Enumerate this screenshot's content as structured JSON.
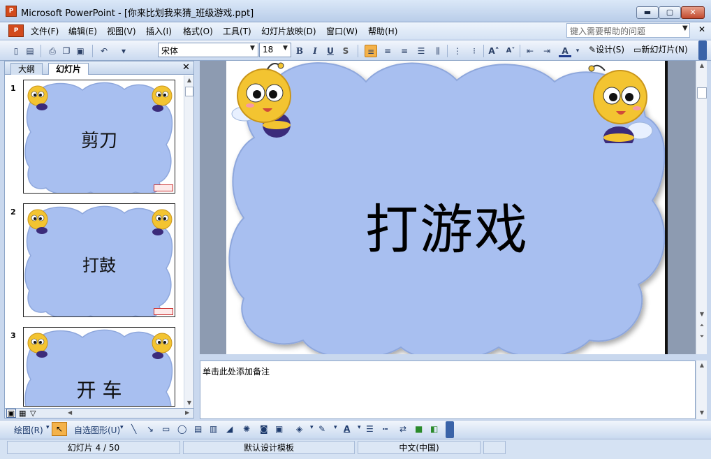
{
  "window": {
    "title": "Microsoft PowerPoint - [你来比划我来猜_班级游戏.ppt]",
    "minimize": "▬",
    "maximize": "▢",
    "close": "✕"
  },
  "menu": {
    "items": [
      "文件(F)",
      "编辑(E)",
      "视图(V)",
      "插入(I)",
      "格式(O)",
      "工具(T)",
      "幻灯片放映(D)",
      "窗口(W)",
      "帮助(H)"
    ],
    "help_placeholder": "键入需要帮助的问题"
  },
  "toolbar": {
    "font_name": "宋体",
    "font_size": "18",
    "bold": "B",
    "italic": "I",
    "underline": "U",
    "shadow": "S",
    "design_label": "设计(S)",
    "new_slide_label": "新幻灯片(N)"
  },
  "left_panel": {
    "tabs": [
      "大纲",
      "幻灯片"
    ],
    "slides": [
      {
        "number": "1",
        "text": "剪刀"
      },
      {
        "number": "2",
        "text": "打鼓"
      },
      {
        "number": "3",
        "text": "开 车"
      }
    ]
  },
  "slide": {
    "title": "打游戏",
    "background_color": "#a8bff0",
    "accent_color": "#f3c431"
  },
  "notes": {
    "placeholder": "单击此处添加备注"
  },
  "drawbar": {
    "draw_label": "绘图(R)",
    "autoshape_label": "自选图形(U)"
  },
  "status": {
    "slide_position": "幻灯片 4 / 50",
    "template": "默认设计模板",
    "language": "中文(中国)"
  }
}
